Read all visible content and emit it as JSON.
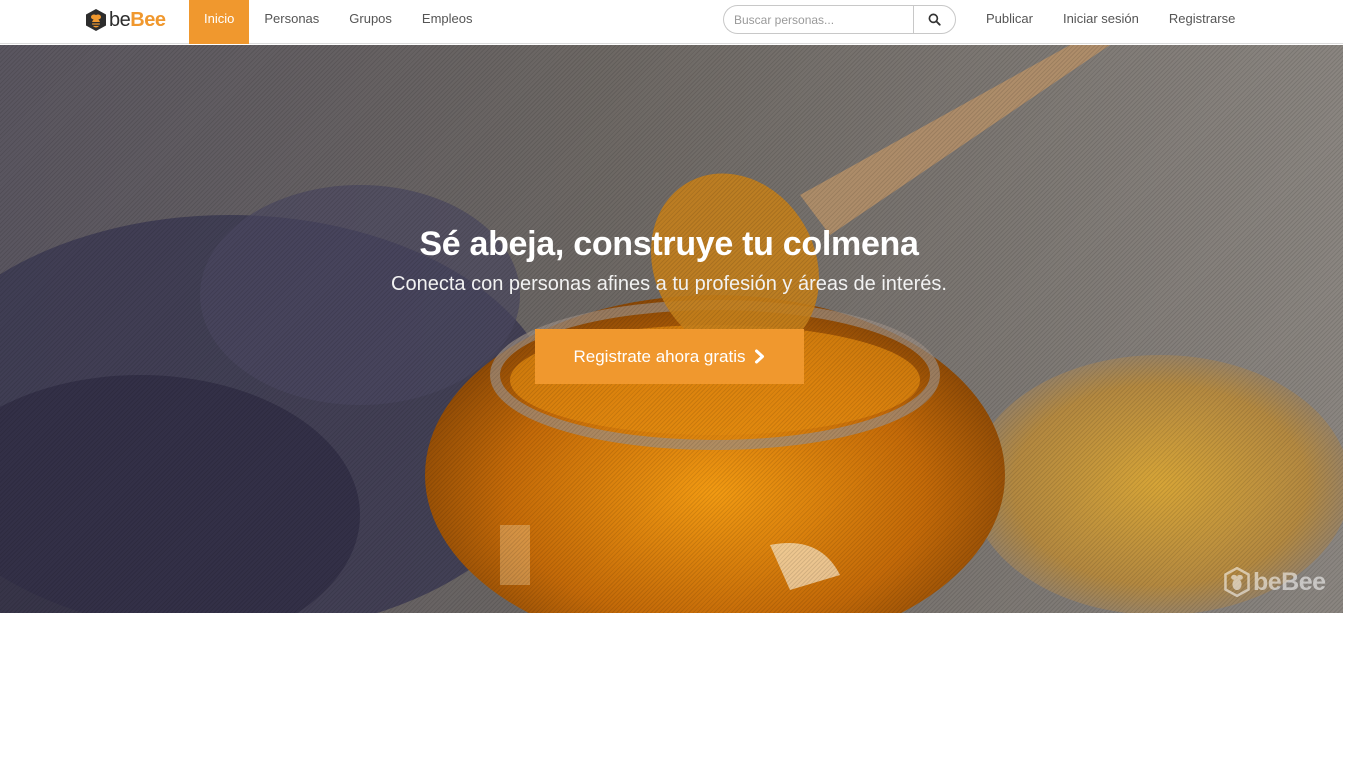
{
  "brand": {
    "logo_be": "be",
    "logo_bee": "Bee",
    "accent": "#f0982e"
  },
  "nav": {
    "items": [
      {
        "label": "Inicio",
        "active": true
      },
      {
        "label": "Personas",
        "active": false
      },
      {
        "label": "Grupos",
        "active": false
      },
      {
        "label": "Empleos",
        "active": false
      }
    ],
    "right": [
      {
        "label": "Publicar"
      },
      {
        "label": "Iniciar sesión"
      },
      {
        "label": "Registrarse"
      }
    ]
  },
  "search": {
    "placeholder": "Buscar personas...",
    "value": "",
    "icon": "search-icon"
  },
  "hero": {
    "title": "Sé abeja, construye tu colmena",
    "subtitle": "Conecta con personas afines a tu profesión y áreas de interés.",
    "cta_label": "Registrate ahora gratis",
    "cta_icon": "chevron-right-icon",
    "watermark": "beBee"
  }
}
